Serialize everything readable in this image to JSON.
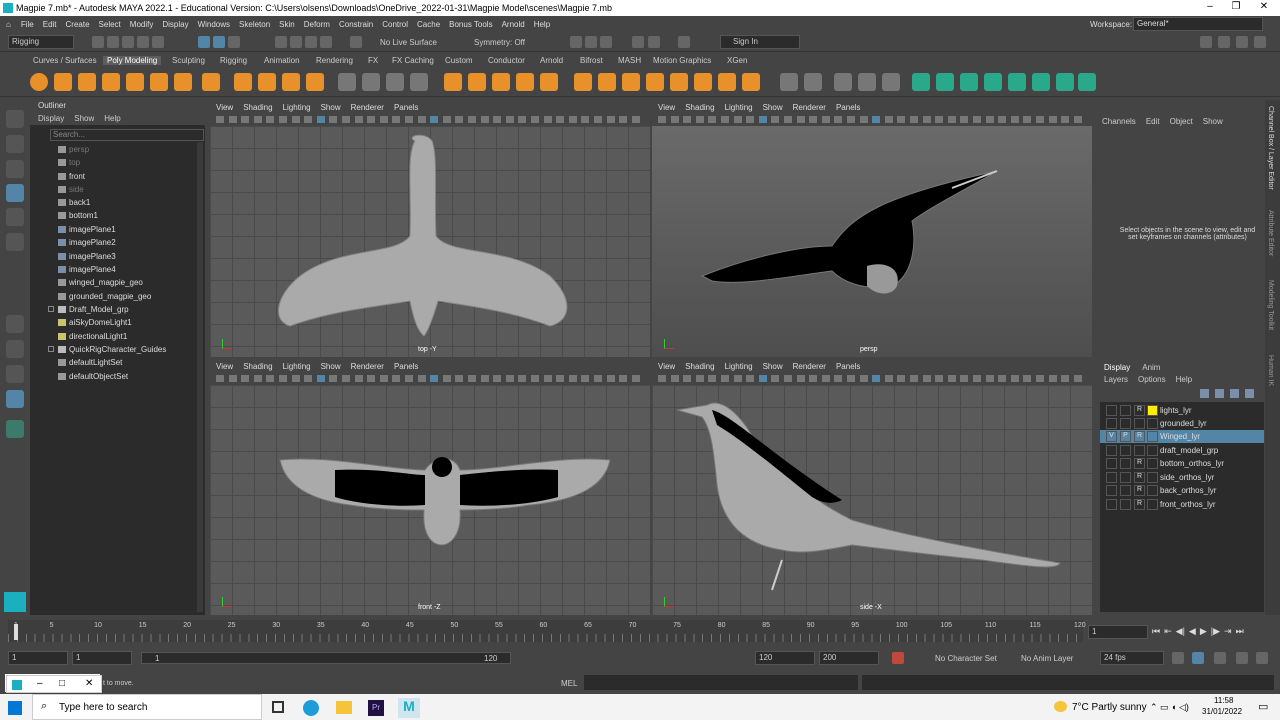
{
  "window": {
    "title": "Magpie 7.mb* - Autodesk MAYA 2022.1 - Educational Version: C:\\Users\\olsens\\Downloads\\OneDrive_2022-01-31\\Magpie Model\\scenes\\Magpie 7.mb"
  },
  "menu": [
    "File",
    "Edit",
    "Create",
    "Select",
    "Modify",
    "Display",
    "Windows",
    "Skeleton",
    "Skin",
    "Deform",
    "Constrain",
    "Control",
    "Cache",
    "Bonus Tools",
    "Arnold",
    "Help"
  ],
  "workspace": {
    "label": "Workspace:",
    "value": "General*"
  },
  "status": {
    "mode": "Rigging",
    "live_surface": "No Live Surface",
    "symmetry": "Symmetry: Off",
    "sign_in": "Sign In"
  },
  "shelf_tabs": [
    "Curves / Surfaces",
    "Poly Modeling",
    "Sculpting",
    "Rigging",
    "Animation",
    "Rendering",
    "FX",
    "FX Caching",
    "Custom",
    "Conductor",
    "Arnold",
    "Bifrost",
    "MASH",
    "Motion Graphics",
    "XGen"
  ],
  "shelf_active": "Poly Modeling",
  "outliner": {
    "title": "Outliner",
    "menu": [
      "Display",
      "Show",
      "Help"
    ],
    "search_placeholder": "Search...",
    "items": [
      {
        "label": "persp",
        "dim": true
      },
      {
        "label": "top",
        "dim": true
      },
      {
        "label": "front",
        "dim": false
      },
      {
        "label": "side",
        "dim": true
      },
      {
        "label": "back1",
        "dim": false
      },
      {
        "label": "bottom1",
        "dim": false
      },
      {
        "label": "imagePlane1",
        "dim": false
      },
      {
        "label": "imagePlane2",
        "dim": false
      },
      {
        "label": "imagePlane3",
        "dim": false
      },
      {
        "label": "imagePlane4",
        "dim": false
      },
      {
        "label": "winged_magpie_geo",
        "dim": false
      },
      {
        "label": "grounded_magpie_geo",
        "dim": false
      },
      {
        "label": "Draft_Model_grp",
        "dim": false
      },
      {
        "label": "aiSkyDomeLight1",
        "dim": false
      },
      {
        "label": "directionalLight1",
        "dim": false
      },
      {
        "label": "QuickRigCharacter_Guides",
        "dim": false
      },
      {
        "label": "defaultLightSet",
        "dim": false
      },
      {
        "label": "defaultObjectSet",
        "dim": false
      }
    ]
  },
  "viewport_menu": [
    "View",
    "Shading",
    "Lighting",
    "Show",
    "Renderer",
    "Panels"
  ],
  "viewports": [
    {
      "label": "top -Y"
    },
    {
      "label": "persp"
    },
    {
      "label": "front -Z"
    },
    {
      "label": "side -X"
    }
  ],
  "channel_box": {
    "menu": [
      "Channels",
      "Edit",
      "Object",
      "Show"
    ],
    "message": "Select objects in the scene to view, edit and set keyframes on channels (attributes)"
  },
  "layer_editor": {
    "tabs": [
      "Display",
      "Anim"
    ],
    "menu": [
      "Layers",
      "Options",
      "Help"
    ],
    "layers": [
      {
        "name": "lights_lyr",
        "v": "",
        "p": "",
        "r": "R",
        "color": "#ffee00",
        "selected": false
      },
      {
        "name": "grounded_lyr",
        "v": "",
        "p": "",
        "r": "",
        "color": "",
        "selected": false
      },
      {
        "name": "Winged_lyr",
        "v": "V",
        "p": "P",
        "r": "R",
        "color": "",
        "selected": true
      },
      {
        "name": "draft_model_grp",
        "v": "",
        "p": "",
        "r": "",
        "color": "",
        "selected": false
      },
      {
        "name": "bottom_orthos_lyr",
        "v": "",
        "p": "",
        "r": "R",
        "color": "",
        "selected": false
      },
      {
        "name": "side_orthos_lyr",
        "v": "",
        "p": "",
        "r": "R",
        "color": "",
        "selected": false
      },
      {
        "name": "back_orthos_lyr",
        "v": "",
        "p": "",
        "r": "R",
        "color": "",
        "selected": false
      },
      {
        "name": "front_orthos_lyr",
        "v": "",
        "p": "",
        "r": "R",
        "color": "",
        "selected": false
      }
    ]
  },
  "side_tabs": [
    "Channel Box / Layer Editor",
    "Attribute Editor",
    "Modeling Toolkit",
    "Human IK"
  ],
  "timeline": {
    "ticks": [
      "1",
      "5",
      "10",
      "15",
      "20",
      "25",
      "30",
      "35",
      "40",
      "45",
      "50",
      "55",
      "60",
      "65",
      "70",
      "75",
      "80",
      "85",
      "90",
      "95",
      "100",
      "105",
      "110",
      "115",
      "120"
    ],
    "current": "1"
  },
  "range": {
    "start": "1",
    "anim_start": "1",
    "slider_start": "1",
    "slider_end": "120",
    "end": "120",
    "anim_end": "200",
    "character": "No Character Set",
    "anim_layer": "No Anim Layer",
    "fps": "24 fps"
  },
  "command": {
    "lang": "MEL",
    "help": "t to move."
  },
  "taskbar": {
    "search": "Type here to search",
    "weather": "7°C  Partly sunny",
    "time": "11:58",
    "date": "31/01/2022"
  }
}
